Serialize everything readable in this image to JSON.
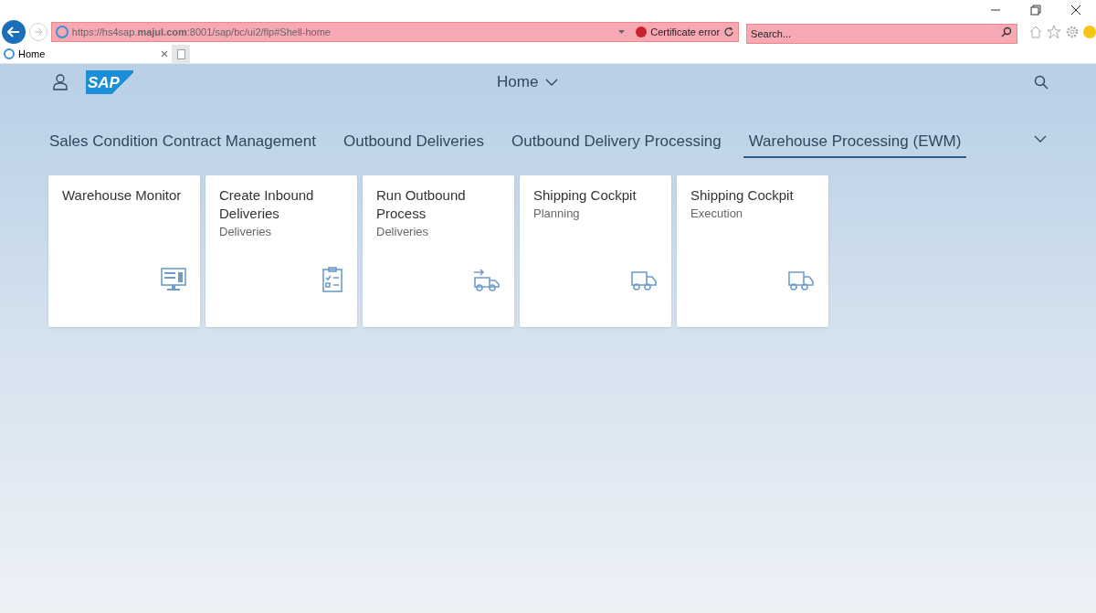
{
  "browser": {
    "url": "https://hs4sap.**majul.com**:8001/sap/bc/ui2/flp#Shell-home",
    "certificate": "Certificate error",
    "search": {
      "placeholder": "Search..."
    },
    "tab": {
      "label": "Home"
    }
  },
  "shell": {
    "logo": "SAP",
    "title": "Home"
  },
  "groups": [
    {
      "label": "Sales Condition Contract Management",
      "selected": false
    },
    {
      "label": "Outbound Deliveries",
      "selected": false
    },
    {
      "label": "Outbound Delivery Processing",
      "selected": false
    },
    {
      "label": "Warehouse Processing (EWM)",
      "selected": true
    }
  ],
  "tiles": [
    {
      "title": "Warehouse Monitor",
      "kind": "monitor"
    },
    {
      "title": "Create Inbound Deliveries",
      "subtitle": "Deliveries",
      "kind": "clipboard"
    },
    {
      "title": "Run Outbound Process",
      "subtitle": "Deliveries",
      "kind": "truck-arrow"
    },
    {
      "title": "Shipping Cockpit",
      "subtitle": "Planning",
      "kind": "truck"
    },
    {
      "title": "Shipping Cockpit",
      "subtitle": "Execution",
      "kind": "truck"
    }
  ]
}
